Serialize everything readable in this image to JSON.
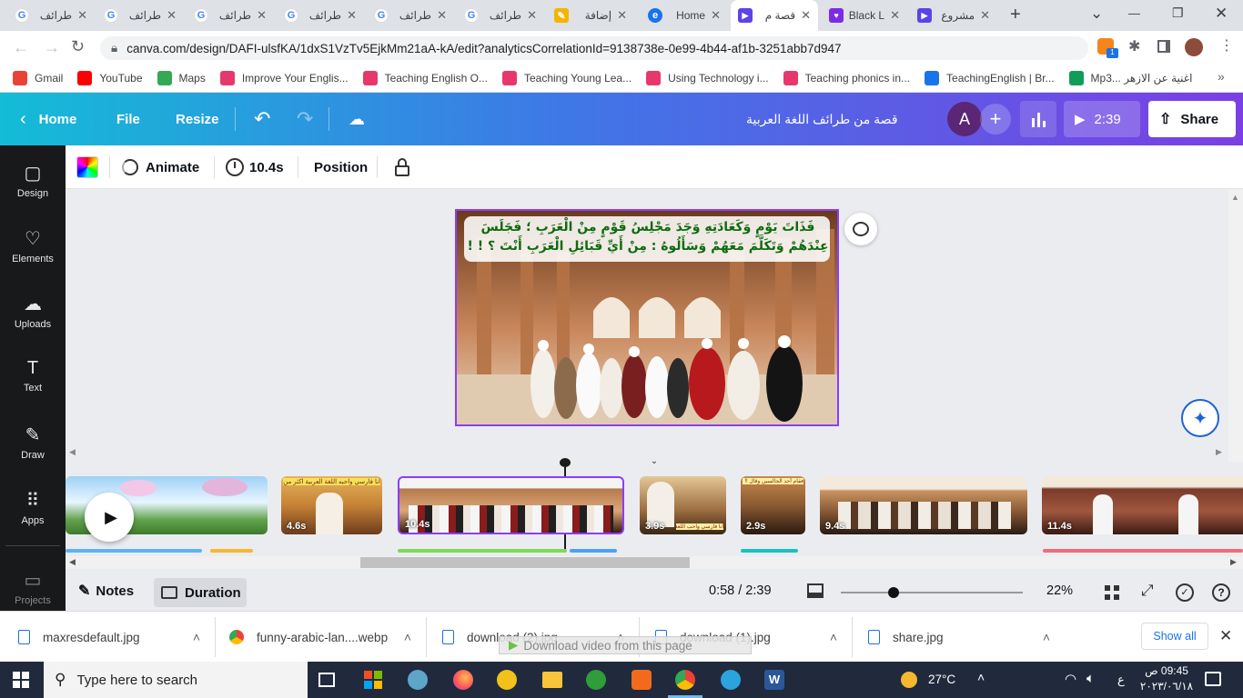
{
  "browser": {
    "tabs": [
      {
        "title": "طرائف",
        "icon": "google-icon"
      },
      {
        "title": "طرائف",
        "icon": "google-icon"
      },
      {
        "title": "طرائف",
        "icon": "google-icon"
      },
      {
        "title": "طرائف",
        "icon": "google-icon"
      },
      {
        "title": "طرائف",
        "icon": "google-icon"
      },
      {
        "title": "طرائف",
        "icon": "google-icon"
      },
      {
        "title": "إضافة",
        "icon": "image-icon"
      },
      {
        "title": "Home",
        "icon": "home-icon"
      },
      {
        "title": "قصة م",
        "icon": "canva-video-icon"
      },
      {
        "title": "Black L",
        "icon": "purple-heart-icon"
      },
      {
        "title": "مشروع",
        "icon": "canva-video-icon"
      }
    ],
    "url": "canva.com/design/DAFI-ulsfKA/1dxS1VzTv5EjkMm21aA-kA/edit?analyticsCorrelationId=9138738e-0e99-4b44-af1b-3251abb7d947",
    "extension_badge": "1",
    "bookmarks": [
      {
        "label": "Gmail",
        "color": "#ea4335"
      },
      {
        "label": "YouTube",
        "color": "#ff0000"
      },
      {
        "label": "Maps",
        "color": "#34a853"
      },
      {
        "label": "Improve Your Englis...",
        "color": "#e8376c"
      },
      {
        "label": "Teaching English O...",
        "color": "#e8376c"
      },
      {
        "label": "Teaching Young Lea...",
        "color": "#e8376c"
      },
      {
        "label": "Using Technology i...",
        "color": "#e8376c"
      },
      {
        "label": "Teaching phonics in...",
        "color": "#e8376c"
      },
      {
        "label": "TeachingEnglish | Br...",
        "color": "#1a73e8"
      },
      {
        "label": "Mp3... اغنية عن الازهر",
        "color": "#0f9d58"
      }
    ]
  },
  "canva": {
    "header": {
      "home": "Home",
      "file": "File",
      "resize": "Resize",
      "design_title": "قصة من طرائف اللغة العربية",
      "avatar_letter": "A",
      "play_time": "2:39",
      "share": "Share"
    },
    "toolbar": {
      "animate": "Animate",
      "duration": "10.4s",
      "position": "Position"
    },
    "sidebar": [
      {
        "label": "Design",
        "icon": "design-icon"
      },
      {
        "label": "Elements",
        "icon": "elements-icon"
      },
      {
        "label": "Uploads",
        "icon": "uploads-icon"
      },
      {
        "label": "Text",
        "icon": "text-icon"
      },
      {
        "label": "Draw",
        "icon": "draw-icon"
      },
      {
        "label": "Apps",
        "icon": "apps-icon"
      },
      {
        "label": "Projects",
        "icon": "projects-icon"
      }
    ],
    "slide_text": "فَذَاتَ يَوْمٍ وَكَعَادَتِهِ وَجَدَ مَجْلِسُ قَوْمٍ مِنْ الْعَرَبِ ؛ فَجَلَسَ عِنْدَهُمْ وَتَكَلَّمَ مَعَهُمْ وَسَأَلُوهُ : مِنْ أَيِّ قَبَائِلِ الْعَرَبِ أَنْتَ ؟ ! !",
    "clips": [
      {
        "duration": "",
        "caption": ""
      },
      {
        "duration": "4.6s",
        "caption": "أنا فارسي واحبه اللغة العربية اكثر من العرب !!!"
      },
      {
        "duration": "10.4s",
        "caption": ""
      },
      {
        "duration": "3.9s",
        "caption": "أنا فارسي واحب اللغة"
      },
      {
        "duration": "2.9s",
        "caption": "فقام أحد الجالسين وقال !!"
      },
      {
        "duration": "9.4s",
        "caption": ""
      },
      {
        "duration": "11.4s",
        "caption": ""
      }
    ],
    "bottom": {
      "notes": "Notes",
      "duration": "Duration",
      "time": "0:58 / 2:39",
      "zoom_level": 0.29,
      "zoom": "22%"
    }
  },
  "downloads": {
    "items": [
      {
        "name": "maxresdefault.jpg"
      },
      {
        "name": "funny-arabic-lan....webp"
      },
      {
        "name": "download (2).jpg"
      },
      {
        "name": "download (1).jpg"
      },
      {
        "name": "share.jpg"
      }
    ],
    "overlay": "Download video from this page",
    "show_all": "Show all"
  },
  "taskbar": {
    "search_placeholder": "Type here to search",
    "weather": "27°C",
    "lang": "ع",
    "time": "09:45 ص",
    "date": "٢٠٢٣/٠٦/١٨"
  }
}
